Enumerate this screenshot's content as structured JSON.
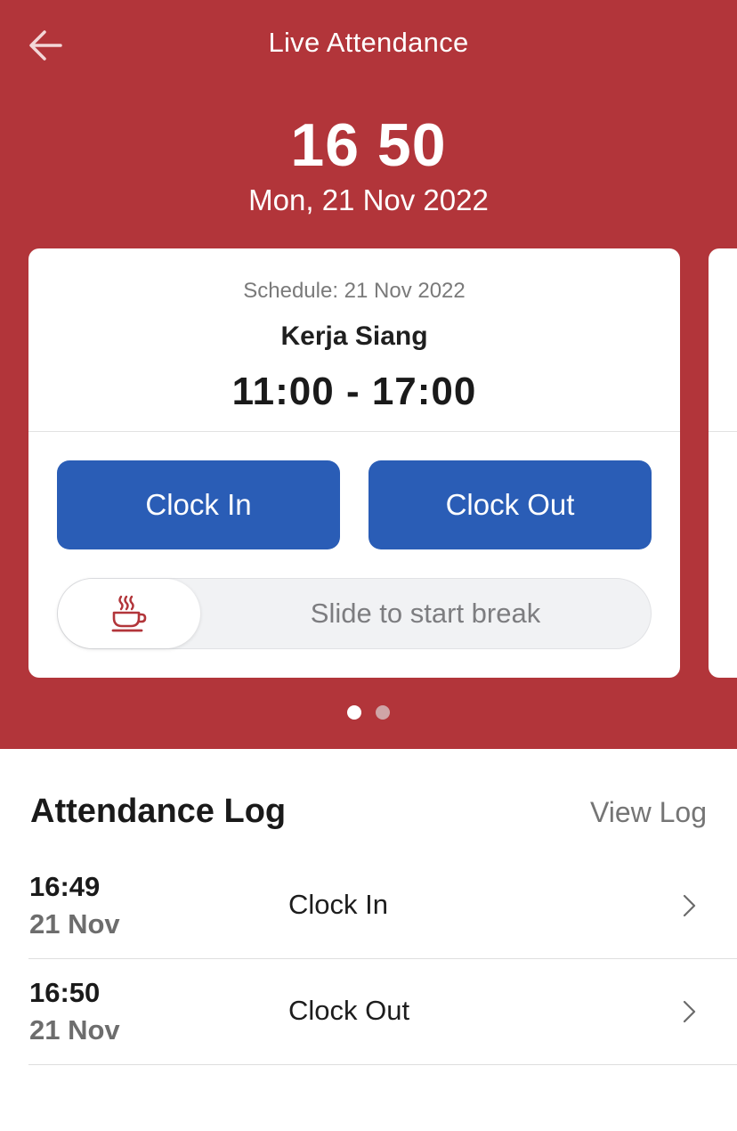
{
  "header": {
    "title": "Live Attendance",
    "current_time": "16 50",
    "current_date": "Mon, 21 Nov 2022"
  },
  "schedule_card": {
    "schedule_date": "Schedule: 21 Nov 2022",
    "shift_name": "Kerja Siang",
    "shift_time": "11:00 - 17:00",
    "clock_in_label": "Clock In",
    "clock_out_label": "Clock Out",
    "break_slider_label": "Slide to start break",
    "break_icon": "coffee-cup-icon"
  },
  "carousel": {
    "pages": 2,
    "active_page": 1
  },
  "attendance_log": {
    "title": "Attendance Log",
    "view_log_label": "View Log",
    "entries": [
      {
        "time": "16:49",
        "date": "21 Nov",
        "event": "Clock In"
      },
      {
        "time": "16:50",
        "date": "21 Nov",
        "event": "Clock Out"
      }
    ]
  },
  "colors": {
    "header_bg": "#b2353a",
    "button_bg": "#2a5db6",
    "break_icon": "#b2353a"
  }
}
